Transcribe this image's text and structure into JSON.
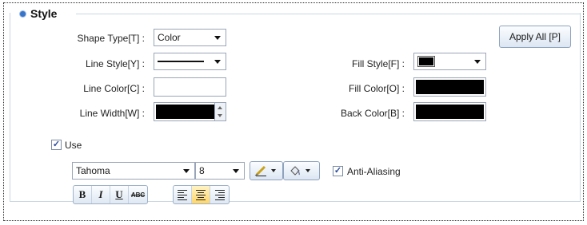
{
  "section": {
    "title": "Style"
  },
  "labels": {
    "shape_type": "Shape Type[T] :",
    "line_style": "Line Style[Y] :",
    "line_color": "Line Color[C] :",
    "line_width": "Line Width[W] :",
    "fill_style": "Fill Style[F] :",
    "fill_color": "Fill Color[O] :",
    "back_color": "Back Color[B] :"
  },
  "shape_type": {
    "value": "Color"
  },
  "apply_all_label": "Apply All [P]",
  "colors": {
    "line_color": "#ffffff",
    "line_width": "#000000",
    "fill_color": "#000000",
    "back_color": "#000000",
    "fill_style_swatch": "#000000",
    "accent": "#3875c9"
  },
  "use": {
    "label": "Use",
    "checked": true
  },
  "font": {
    "name": "Tahoma",
    "size": "8"
  },
  "anti_aliasing": {
    "label": "Anti-Aliasing",
    "checked": true
  },
  "format_buttons": [
    "B",
    "I",
    "U",
    "ABC"
  ],
  "icons": [
    "pencil-icon",
    "paint-bucket-icon",
    "align-left-icon",
    "align-center-icon",
    "align-right-icon"
  ]
}
